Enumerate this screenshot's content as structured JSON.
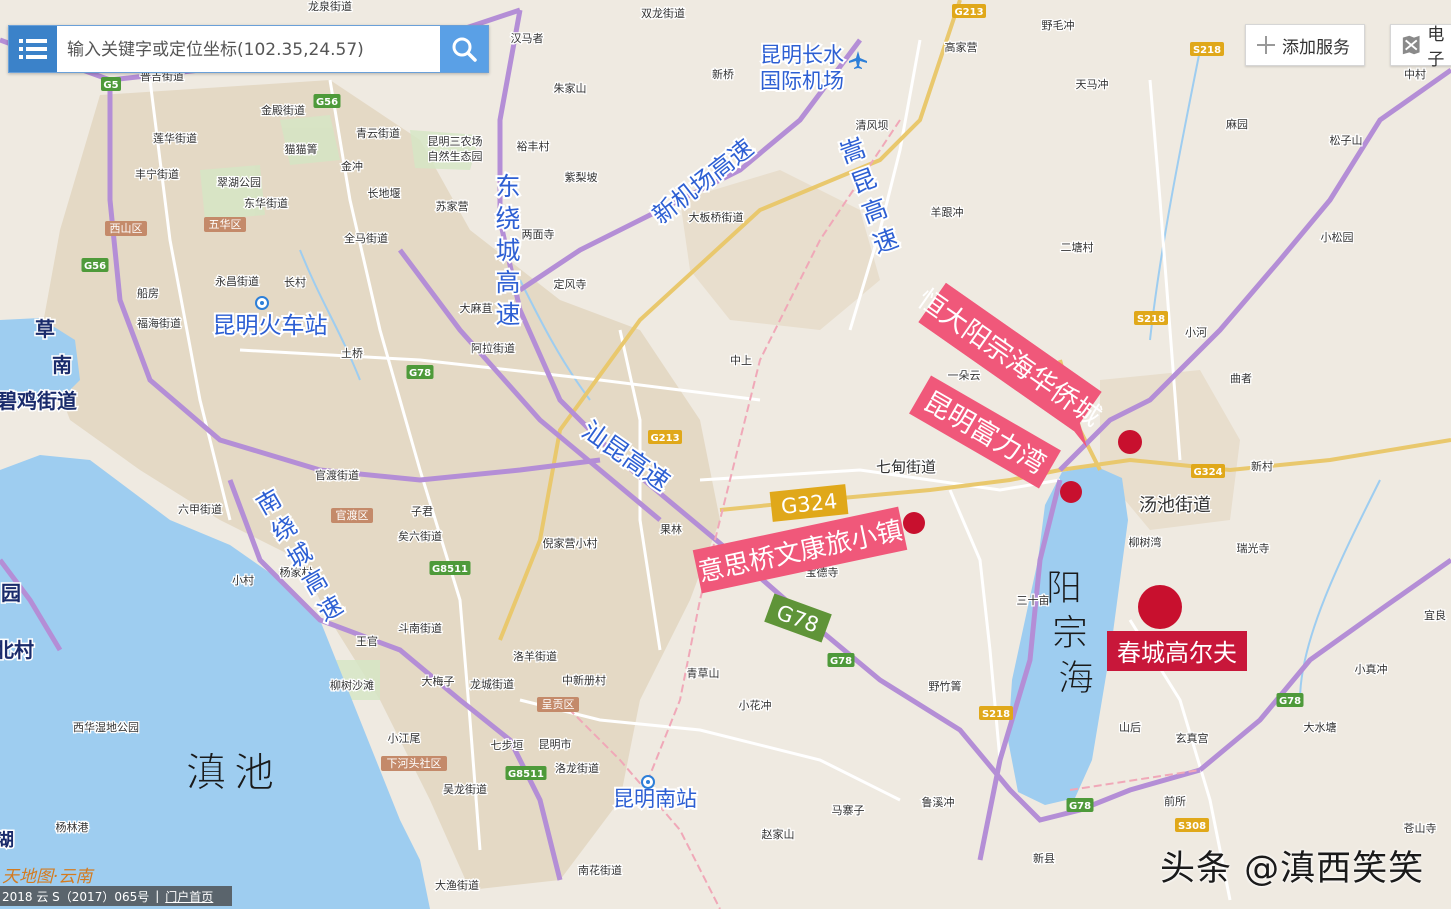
{
  "colors": {
    "land": "#efeae1",
    "water": "#9ecdf0",
    "urban": "#e4d9c5",
    "expressway": "#b48ed6",
    "national_road": "#e9c86d",
    "provincial_road": "#ffffff",
    "annotation_blue": "#2d5fd3",
    "marker_red": "#c8102e",
    "banner_pink": "#f0587a",
    "banner_red": "#c8173a",
    "shield_green": "#4e9a3a",
    "shield_yellow": "#e0a81a",
    "ui_blue": "#3b82c9"
  },
  "search": {
    "placeholder": "输入关键字或定位坐标(102.35,24.57)",
    "menu_icon": "list-icon",
    "search_icon": "search-icon"
  },
  "toolbar": {
    "add_service_label": "添加服务",
    "add_service_icon": "plus-icon",
    "electronic_label": "电子",
    "electronic_icon": "map-layer-icon"
  },
  "map": {
    "blue_labels": [
      {
        "text": "昆明长水"
      },
      {
        "text": "国际机场"
      },
      {
        "text": "新机场高速"
      },
      {
        "text": "东绕城高速"
      },
      {
        "text": "嵩昆高速"
      },
      {
        "text": "昆明火车站"
      },
      {
        "text": "汕昆高速"
      },
      {
        "text": "南绕城高速"
      },
      {
        "text": "昆明南站"
      }
    ],
    "big_labels": [
      {
        "text": "滇池"
      },
      {
        "text": "阳宗海"
      }
    ],
    "place_labels": [
      {
        "text": "龙泉街道"
      },
      {
        "text": "普吉街道"
      },
      {
        "text": "金殿街道"
      },
      {
        "text": "青云街道"
      },
      {
        "text": "莲华街道"
      },
      {
        "text": "猫猫箐"
      },
      {
        "text": "昆明三农场"
      },
      {
        "text": "自然生态园"
      },
      {
        "text": "丰宁街道"
      },
      {
        "text": "翠湖公园"
      },
      {
        "text": "东华街道"
      },
      {
        "text": "长地堰"
      },
      {
        "text": "苏家营"
      },
      {
        "text": "西山区"
      },
      {
        "text": "五华区"
      },
      {
        "text": "全马街道"
      },
      {
        "text": "两面寺"
      },
      {
        "text": "大板桥街道"
      },
      {
        "text": "永昌街道"
      },
      {
        "text": "长村"
      },
      {
        "text": "定风寺"
      },
      {
        "text": "船房"
      },
      {
        "text": "福海街道"
      },
      {
        "text": "大麻苴"
      },
      {
        "text": "阿拉街道"
      },
      {
        "text": "中上"
      },
      {
        "text": "一朵云"
      },
      {
        "text": "土桥"
      },
      {
        "text": "七甸街道"
      },
      {
        "text": "汤池街道"
      },
      {
        "text": "官渡街道"
      },
      {
        "text": "官渡区"
      },
      {
        "text": "六甲街道"
      },
      {
        "text": "子君"
      },
      {
        "text": "矣六街道"
      },
      {
        "text": "果林"
      },
      {
        "text": "倪家营小村"
      },
      {
        "text": "宝德寺"
      },
      {
        "text": "三十亩"
      },
      {
        "text": "柳树湾"
      },
      {
        "text": "小村"
      },
      {
        "text": "杨家村"
      },
      {
        "text": "斗南街道"
      },
      {
        "text": "洛羊街道"
      },
      {
        "text": "中新册村"
      },
      {
        "text": "青草山"
      },
      {
        "text": "王官"
      },
      {
        "text": "柳树沙滩"
      },
      {
        "text": "大梅子"
      },
      {
        "text": "龙城街道"
      },
      {
        "text": "呈贡区"
      },
      {
        "text": "小花冲"
      },
      {
        "text": "野竹箐"
      },
      {
        "text": "西华湿地公园"
      },
      {
        "text": "小江尾"
      },
      {
        "text": "七步垣"
      },
      {
        "text": "昆明市"
      },
      {
        "text": "下河头社区"
      },
      {
        "text": "吴龙街道"
      },
      {
        "text": "洛龙街道"
      },
      {
        "text": "马寨子"
      },
      {
        "text": "鲁溪冲"
      },
      {
        "text": "赵家山"
      },
      {
        "text": "杨林港"
      },
      {
        "text": "南花街道"
      },
      {
        "text": "大渔街道"
      },
      {
        "text": "新县"
      },
      {
        "text": "山后"
      },
      {
        "text": "前所"
      },
      {
        "text": "玄真宫"
      },
      {
        "text": "大水塘"
      },
      {
        "text": "小真冲"
      },
      {
        "text": "苍山寺"
      },
      {
        "text": "中村"
      },
      {
        "text": "麻园"
      },
      {
        "text": "松子山"
      },
      {
        "text": "小松园"
      },
      {
        "text": "羊跟冲"
      },
      {
        "text": "二塘村"
      },
      {
        "text": "小河"
      },
      {
        "text": "曲者"
      },
      {
        "text": "新村"
      },
      {
        "text": "瑞光寺"
      },
      {
        "text": "宜良"
      },
      {
        "text": "高家营"
      },
      {
        "text": "朱家山"
      },
      {
        "text": "新桥"
      },
      {
        "text": "双龙街道"
      },
      {
        "text": "汉马者"
      },
      {
        "text": "野毛冲"
      },
      {
        "text": "天马冲"
      },
      {
        "text": "清风坝"
      },
      {
        "text": "裕丰村"
      },
      {
        "text": "紫梨坡"
      },
      {
        "text": "金冲"
      }
    ],
    "road_shields": [
      {
        "code": "G5",
        "color": "green"
      },
      {
        "code": "G56",
        "color": "green"
      },
      {
        "code": "G56",
        "color": "green"
      },
      {
        "code": "G78",
        "color": "green"
      },
      {
        "code": "G213",
        "color": "yellow"
      },
      {
        "code": "G213",
        "color": "yellow"
      },
      {
        "code": "G8511",
        "color": "green"
      },
      {
        "code": "G8511",
        "color": "green"
      },
      {
        "code": "G78",
        "color": "green"
      },
      {
        "code": "S218",
        "color": "yellow"
      },
      {
        "code": "S218",
        "color": "yellow"
      },
      {
        "code": "S218",
        "color": "yellow"
      },
      {
        "code": "G324",
        "color": "yellow"
      },
      {
        "code": "G78",
        "color": "green"
      },
      {
        "code": "G78",
        "color": "green"
      },
      {
        "code": "S308",
        "color": "yellow"
      }
    ],
    "big_shields": [
      {
        "code": "G324",
        "color": "yellow"
      },
      {
        "code": "G78",
        "color": "green"
      }
    ],
    "banners": [
      {
        "text": "恒大阳宗海华侨城",
        "style": "pink"
      },
      {
        "text": "昆明富力湾",
        "style": "pink"
      },
      {
        "text": "意思桥文康旅小镇",
        "style": "pink"
      },
      {
        "text": "春城高尔夫",
        "style": "red"
      }
    ],
    "markers": [
      {
        "name": "恒大阳宗海华侨城"
      },
      {
        "name": "昆明富力湾"
      },
      {
        "name": "意思桥文康旅小镇"
      },
      {
        "name": "春城高尔夫"
      }
    ],
    "edge_labels": [
      {
        "text": "草"
      },
      {
        "text": "南"
      },
      {
        "text": "碧鸡街道"
      },
      {
        "text": "园"
      },
      {
        "text": "北村"
      },
      {
        "text": "湖"
      }
    ]
  },
  "footer": {
    "logo_text": "天地图·云南",
    "copyright": "2018 云 S（2017）065号",
    "separator": "|",
    "portal_link": "门户首页"
  },
  "watermark": "头条 @滇西笑笑"
}
